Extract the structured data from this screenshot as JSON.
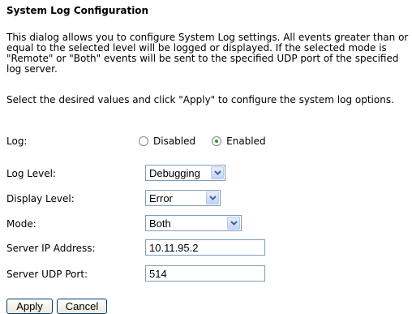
{
  "page": {
    "title": "System Log Configuration",
    "intro": "This dialog allows you to configure System Log settings. All events greater than or equal to the selected level will be logged or displayed. If the selected mode is \"Remote\" or \"Both\" events will be sent to the specified UDP port of the specified log server.",
    "instruction": "Select the desired values and click \"Apply\" to configure the system log options."
  },
  "log": {
    "label": "Log:",
    "options": [
      "Disabled",
      "Enabled"
    ],
    "selected": "Enabled"
  },
  "log_level": {
    "label": "Log Level:",
    "value": "Debugging"
  },
  "display_level": {
    "label": "Display Level:",
    "value": "Error"
  },
  "mode": {
    "label": "Mode:",
    "value": "Both"
  },
  "server_ip": {
    "label": "Server IP Address:",
    "value": "10.11.95.2"
  },
  "server_port": {
    "label": "Server UDP Port:",
    "value": "514"
  },
  "buttons": {
    "apply": "Apply",
    "cancel": "Cancel"
  },
  "icons": {
    "dropdown": "chevron-down-icon",
    "accent": "#20a020"
  }
}
